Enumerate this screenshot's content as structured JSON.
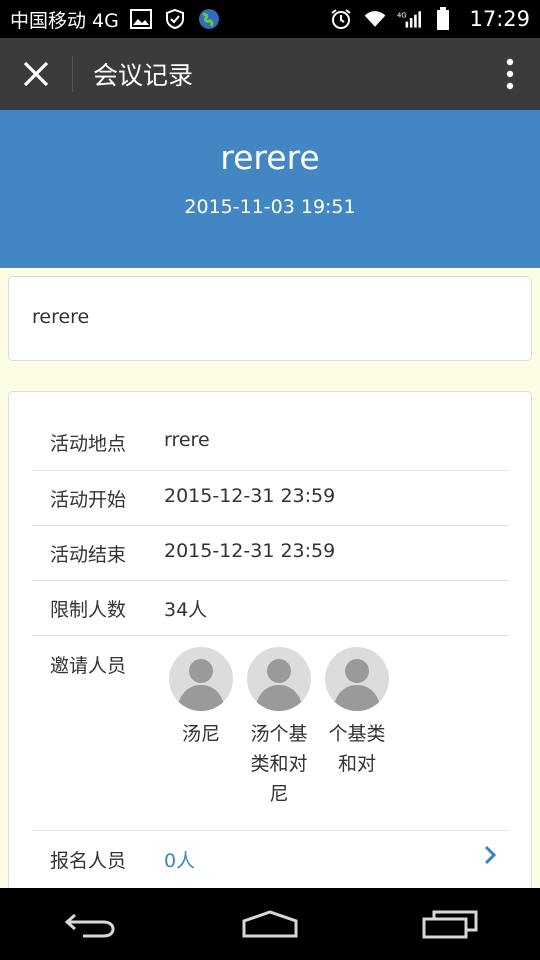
{
  "status_bar": {
    "carrier": "中国移动 4G",
    "time": "17:29",
    "icons": [
      "image-icon",
      "shield-icon",
      "globe-icon",
      "alarm-icon",
      "wifi-icon",
      "signal-4g-icon",
      "battery-icon"
    ]
  },
  "app_bar": {
    "title": "会议记录",
    "icons": [
      "close-icon",
      "more-vert-icon"
    ]
  },
  "header": {
    "title": "rerere",
    "datetime": "2015-11-03 19:51"
  },
  "description": "rerere",
  "details": {
    "location_label": "活动地点",
    "location_value": "rrere",
    "start_label": "活动开始",
    "start_value": "2015-12-31 23:59",
    "end_label": "活动结束",
    "end_value": "2015-12-31 23:59",
    "limit_label": "限制人数",
    "limit_value": "34人",
    "invited_label": "邀请人员",
    "invited": [
      {
        "name": "汤尼"
      },
      {
        "name": "汤个基类和对尼"
      },
      {
        "name": "个基类和对"
      }
    ],
    "signup_label": "报名人员",
    "signup_value": "0人"
  },
  "nav_bar": {
    "icons": [
      "back-icon",
      "home-icon",
      "recents-icon"
    ]
  },
  "colors": {
    "header_bg": "#4287c4",
    "app_bar_bg": "#3b3b3d",
    "page_bg": "#fdfde6",
    "link": "#3a85c3"
  }
}
